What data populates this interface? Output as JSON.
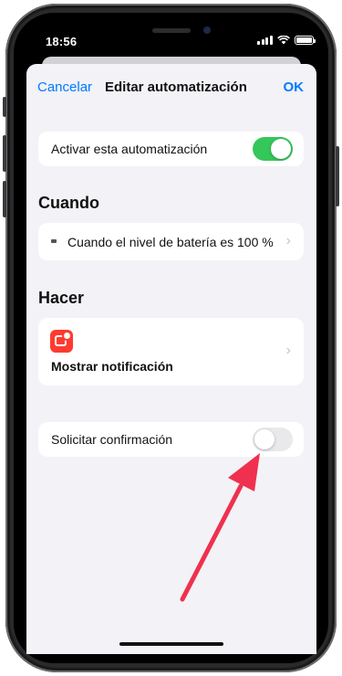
{
  "status_bar": {
    "time": "18:56"
  },
  "nav": {
    "cancel_label": "Cancelar",
    "title": "Editar automatización",
    "ok_label": "OK"
  },
  "enable_row": {
    "label": "Activar esta automatización",
    "toggle_on": true
  },
  "when_section": {
    "heading": "Cuando",
    "trigger_label": "Cuando el nivel de batería es 100 %",
    "trigger_icon": "battery-icon"
  },
  "do_section": {
    "heading": "Hacer",
    "action_label": "Mostrar notificación",
    "action_icon": "notification-icon",
    "action_icon_color": "#ff3b30"
  },
  "confirm_row": {
    "label": "Solicitar confirmación",
    "toggle_on": false
  },
  "colors": {
    "accent": "#007aff",
    "toggle_on": "#34c759",
    "annotation_arrow": "#f0304f"
  }
}
